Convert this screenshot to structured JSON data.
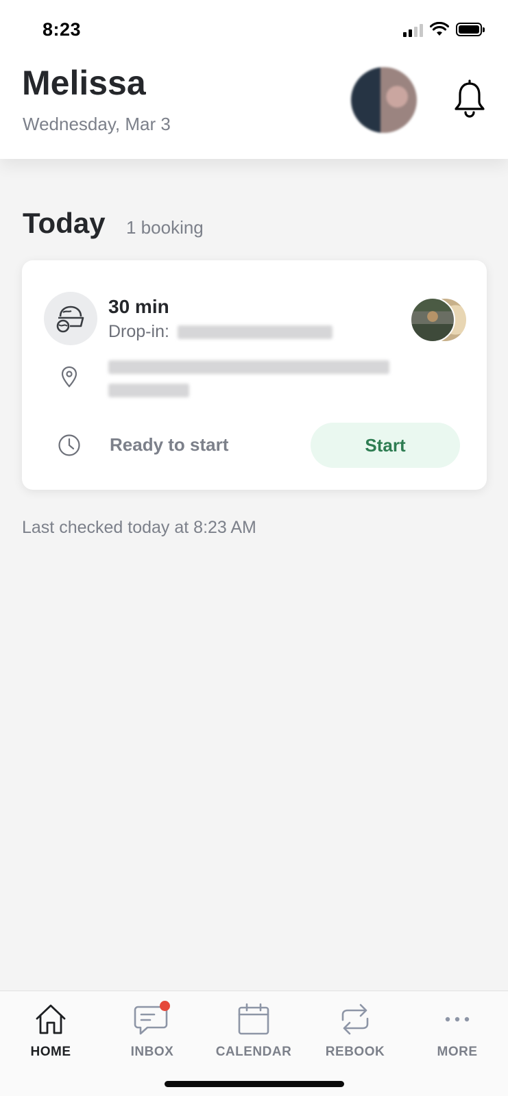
{
  "status_bar": {
    "time": "8:23"
  },
  "header": {
    "name": "Melissa",
    "date": "Wednesday, Mar 3",
    "avatar": "user-avatar-photo",
    "notification_icon": "bell-icon"
  },
  "section": {
    "title": "Today",
    "count": "1 booking"
  },
  "booking": {
    "duration": "30 min",
    "service_prefix": "Drop-in:",
    "service_icon": "pet-bowl-icon",
    "location_icon": "map-pin-icon",
    "status_icon": "clock-icon",
    "status_text": "Ready to start",
    "action_label": "Start",
    "accent_color": "#2e7d52",
    "action_bg": "#eaf8f0"
  },
  "footer": {
    "last_checked": "Last checked today at 8:23 AM"
  },
  "nav": {
    "items": [
      {
        "label": "HOME",
        "icon": "home-icon",
        "active": true
      },
      {
        "label": "INBOX",
        "icon": "chat-icon",
        "badge": true,
        "badge_color": "#e5483a"
      },
      {
        "label": "CALENDAR",
        "icon": "calendar-icon"
      },
      {
        "label": "REBOOK",
        "icon": "repeat-icon"
      },
      {
        "label": "MORE",
        "icon": "more-icon"
      }
    ]
  }
}
